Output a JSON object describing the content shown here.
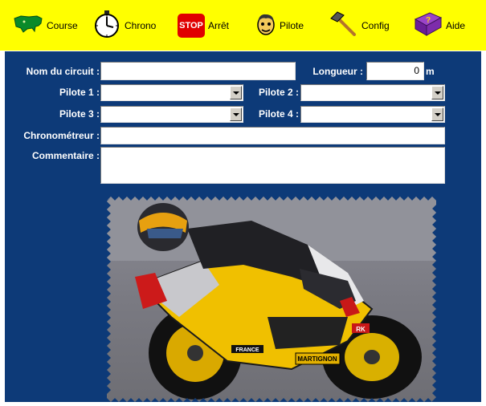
{
  "toolbar": {
    "course": "Course",
    "chrono": "Chrono",
    "arret_badge": "STOP",
    "arret": "Arrêt",
    "pilote": "Pilote",
    "config": "Config",
    "aide": "Aide"
  },
  "form": {
    "nom_circuit_label": "Nom du circuit :",
    "nom_circuit_value": "",
    "longueur_label": "Longueur :",
    "longueur_value": "0",
    "longueur_unit": "m",
    "pilote1_label": "Pilote 1 :",
    "pilote1_value": "",
    "pilote2_label": "Pilote 2 :",
    "pilote2_value": "",
    "pilote3_label": "Pilote 3 :",
    "pilote3_value": "",
    "pilote4_label": "Pilote 4 :",
    "pilote4_value": "",
    "chrono_label": "Chronométreur :",
    "chrono_value": "",
    "commentaire_label": "Commentaire :",
    "commentaire_value": ""
  },
  "photo": {
    "sponsor_france": "FRANCE",
    "sponsor_martignon": "MARTIGNON",
    "plate": "RK"
  },
  "colors": {
    "toolbar_bg": "#ffff00",
    "panel_bg": "#0d3a78",
    "stop_red": "#e00000"
  }
}
